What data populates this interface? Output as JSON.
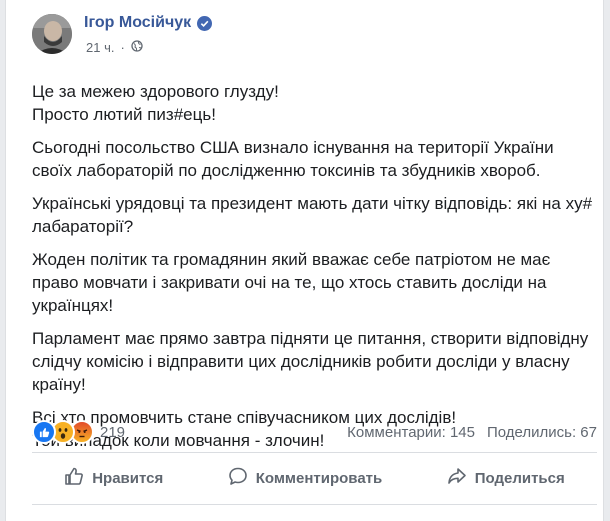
{
  "post": {
    "author": "Ігор Мосійчук",
    "time": "21 ч.",
    "paragraphs": [
      "Це за межею здорового глузду!\nПросто лютий пиз#ець!",
      "Сьогодні посольство США визнало існування на території України своїх лабораторій по дослідженню токсинів та збудників хвороб.",
      "Українські урядовці та президент мають дати чітку відповідь: які на ху# лабараторії?",
      "Жоден політик та громадянин який вважає себе патріотом не має право мовчати і закривати очі на те, що хтось ставить досліди на українцях!",
      "Парламент має прямо завтра підняти це питання, створити відповідну слідчу комісію і відправити цих дослідників робити досліди у власну країну!",
      "Всі хто промовчить стане співучасником цих дослідів!\nТой випадок коли мовчання - злочин!"
    ]
  },
  "stats": {
    "reactions_count": "219",
    "comments": "Комментарии: 145",
    "shares": "Поделились: 67"
  },
  "actions": {
    "like": "Нравится",
    "comment": "Комментировать",
    "share": "Поделиться"
  },
  "colors": {
    "author": "#385898",
    "like_reaction": "#1877f2",
    "wow_reaction": "#f7b125",
    "angry_reaction": "#e9710f"
  }
}
